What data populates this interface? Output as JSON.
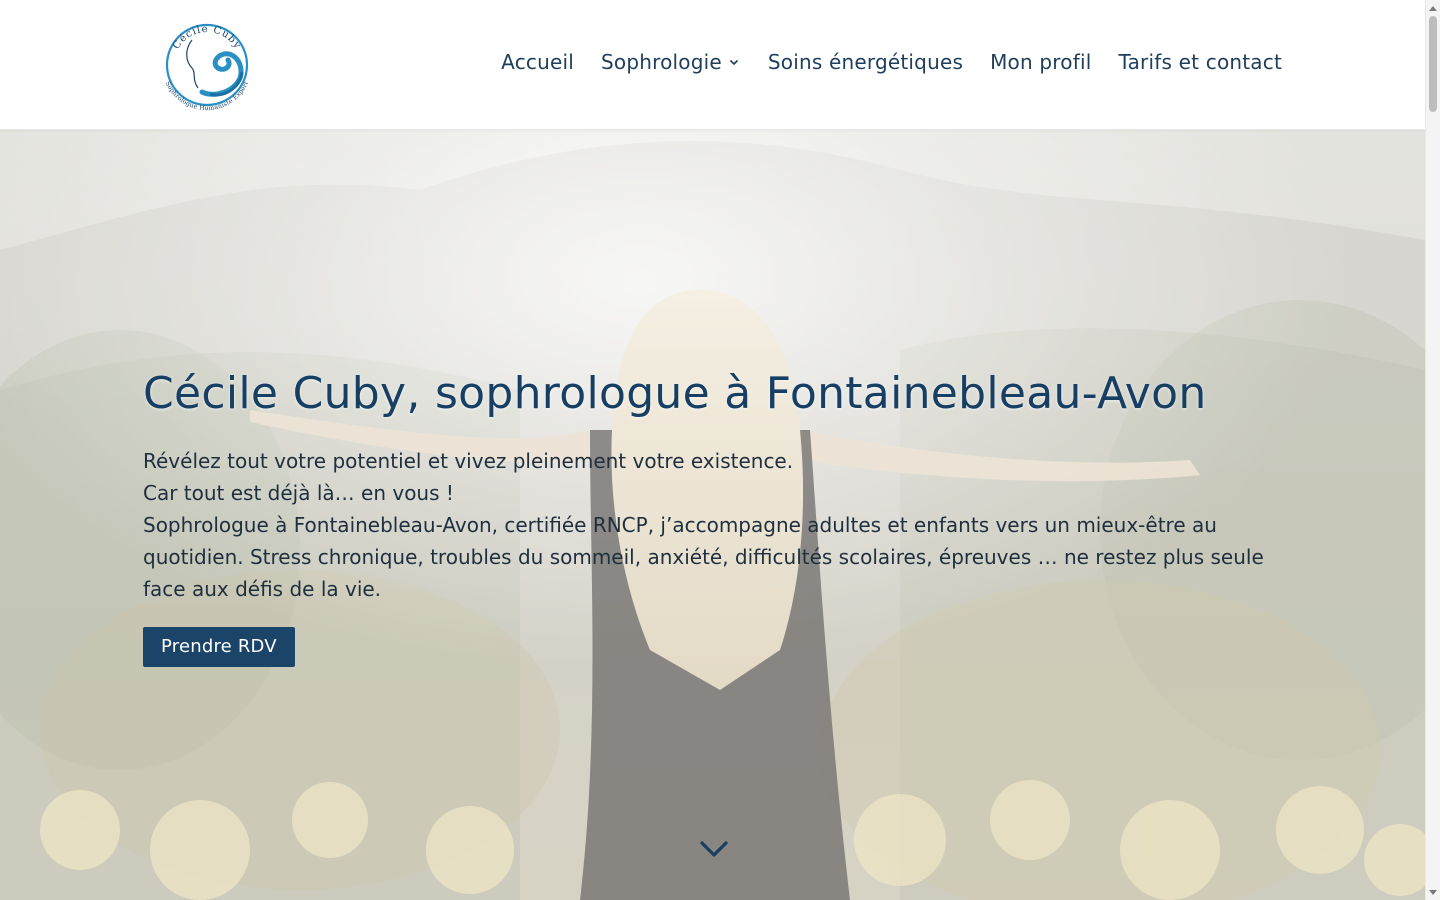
{
  "logo": {
    "top_text": "Cécile Cuby",
    "bottom_text": "Sophrologue Humaniste Expert",
    "colors": {
      "primary": "#2a8fc4",
      "dark": "#1a4468"
    }
  },
  "nav": {
    "items": [
      {
        "label": "Accueil"
      },
      {
        "label": "Sophrologie",
        "has_dropdown": true,
        "icon": "chevron-down-icon"
      },
      {
        "label": "Soins énergétiques"
      },
      {
        "label": "Mon profil"
      },
      {
        "label": "Tarifs et contact"
      }
    ],
    "color": "#1e3e5c"
  },
  "hero": {
    "title": "Cécile Cuby, sophrologue à Fontainebleau-Avon",
    "paragraphs": [
      "Révélez tout votre potentiel et vivez pleinement votre existence.",
      "Car tout est déjà là… en vous !",
      "Sophrologue à Fontainebleau-Avon, certifiée RNCP, j’accompagne adultes et enfants vers un mieux-être au quotidien. Stress chronique, troubles du sommeil, anxiété, difficultés scolaires, épreuves … ne restez plus seule face aux défis de la vie."
    ],
    "cta_label": "Prendre RDV",
    "scroll_icon": "chevron-down-icon",
    "title_color": "#173e63",
    "button_color": "#1a4468"
  }
}
